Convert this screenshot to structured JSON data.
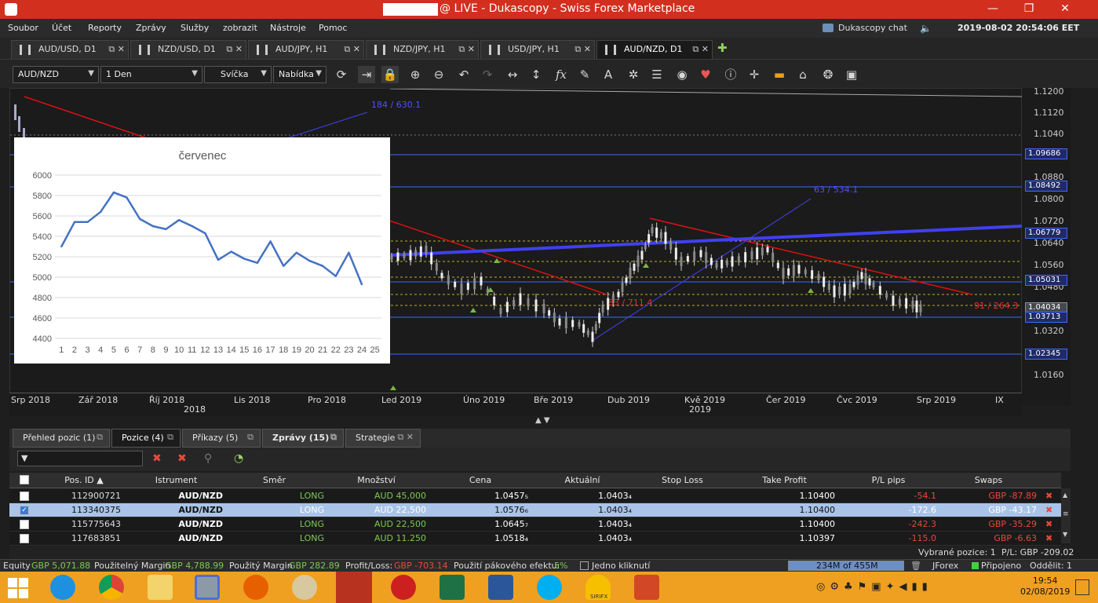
{
  "window": {
    "title": "@ LIVE - Dukascopy - Swiss Forex Marketplace",
    "minimize": "—",
    "maximize": "❐",
    "close": "✕"
  },
  "menu": [
    "Soubor",
    "Účet",
    "Reporty",
    "Zprávy",
    "Služby",
    "zobrazit",
    "Nástroje",
    "Pomoc"
  ],
  "header": {
    "chat_label": "Dukascopy chat",
    "datetime": "2019-08-02 20:54:06 EET"
  },
  "tabs": [
    "AUD/USD, D1",
    "NZD/USD, D1",
    "AUD/JPY, H1",
    "NZD/JPY, H1",
    "USD/JPY, H1",
    "AUD/NZD, D1"
  ],
  "tab_icons": "⧉ ✕",
  "toolbar": {
    "instrument": "AUD/NZD",
    "period": "1 Den",
    "chart_type": "Svíčka",
    "side": "Nabídka"
  },
  "price_axis": {
    "labels": [
      "1.1200",
      "1.1120",
      "1.1040",
      "1.0880",
      "1.0800",
      "1.0720",
      "1.0640",
      "1.0560",
      "1.0480",
      "1.0320",
      "1.0160"
    ],
    "boxes": [
      "1.09686",
      "1.08492",
      "1.06779",
      "1.05031",
      "1.04034",
      "1.03713",
      "1.02345"
    ]
  },
  "time_axis": {
    "months": [
      "Srp 2018",
      "Zář 2018",
      "Říj 2018",
      "Lis 2018",
      "Pro 2018",
      "Led 2019",
      "Úno 2019",
      "Bře 2019",
      "Dub 2019",
      "Kvě 2019",
      "Čer 2019",
      "Čvc 2019",
      "Srp 2019",
      "IX"
    ],
    "years": [
      "2018",
      "2019"
    ]
  },
  "chart_annotations": {
    "a1": "184 / 630.1",
    "a2": "63 / 534.1",
    "a3": "83 / 711.4",
    "a4": "91 / 264.3"
  },
  "chart_data": {
    "type": "line",
    "title": "červenec",
    "x": [
      1,
      2,
      3,
      4,
      5,
      6,
      7,
      8,
      9,
      10,
      11,
      12,
      13,
      14,
      15,
      16,
      17,
      18,
      19,
      20,
      21,
      22,
      23,
      24
    ],
    "x_ticks": [
      1,
      2,
      3,
      4,
      5,
      6,
      7,
      8,
      9,
      10,
      11,
      12,
      13,
      14,
      15,
      16,
      17,
      18,
      19,
      20,
      21,
      22,
      23,
      24,
      25
    ],
    "y_ticks": [
      4400,
      4600,
      4800,
      5000,
      5200,
      5400,
      5600,
      5800,
      6000
    ],
    "series": [
      {
        "values": [
          5300,
          5540,
          5540,
          5640,
          5830,
          5780,
          5570,
          5500,
          5470,
          5560,
          5500,
          5430,
          5170,
          5250,
          5180,
          5140,
          5350,
          5110,
          5240,
          5160,
          5110,
          5010,
          5240,
          4930
        ]
      }
    ],
    "ylim": [
      4400,
      6000
    ],
    "color": "#4472c4"
  },
  "positions": {
    "tabs": [
      {
        "label": "Přehled pozic (1)"
      },
      {
        "label": "Pozice (4)"
      },
      {
        "label": "Příkazy (5)"
      },
      {
        "label": "Zprávy (15)"
      },
      {
        "label": "Strategie"
      }
    ],
    "columns": [
      "Pos. ID",
      "Istrument",
      "Směr",
      "Množství",
      "Cena",
      "Aktuální",
      "Stop Loss",
      "Take Profit",
      "P/L pips",
      "Swaps"
    ],
    "rows": [
      {
        "id": "112900721",
        "instrument": "AUD/NZD",
        "dir": "LONG",
        "amount": "AUD 45,000",
        "price": "1.0457₅",
        "current": "1.0403₄",
        "sl": "",
        "tp": "1.10400",
        "pl": "-54.1",
        "swaps": "GBP -87.89",
        "checked": false
      },
      {
        "id": "113340375",
        "instrument": "AUD/NZD",
        "dir": "LONG",
        "amount": "AUD 22,500",
        "price": "1.0576₆",
        "current": "1.0403₄",
        "sl": "",
        "tp": "1.10400",
        "pl": "-172.6",
        "swaps": "GBP -43.17",
        "checked": true
      },
      {
        "id": "115775643",
        "instrument": "AUD/NZD",
        "dir": "LONG",
        "amount": "AUD 22,500",
        "price": "1.0645₇",
        "current": "1.0403₄",
        "sl": "",
        "tp": "1.10400",
        "pl": "-242.3",
        "swaps": "GBP -35.29",
        "checked": false
      },
      {
        "id": "117683851",
        "instrument": "AUD/NZD",
        "dir": "LONG",
        "amount": "AUD 11.250",
        "price": "1.0518₄",
        "current": "1.0403₄",
        "sl": "",
        "tp": "1.10397",
        "pl": "-115.0",
        "swaps": "GBP -6.63",
        "checked": false
      }
    ],
    "summary_selected": "Vybrané pozice:  1",
    "summary_pl": "P/L:  GBP -209.02"
  },
  "status": {
    "equity_label": "Equity",
    "equity": "GBP 5,071.88",
    "usable_margin_label": "Použitelný Margin",
    "usable_margin": "GBP 4,788.99",
    "used_margin_label": "Použitý Margin",
    "used_margin": "GBP 282.89",
    "pl_label": "Profit/Loss:",
    "pl": "GBP -703.14",
    "leverage_label": "Použití pákového efektu:",
    "leverage": "5%",
    "one_click": "Jedno kliknutí",
    "memory": "234M of 455M",
    "platform": "JForex",
    "connection": "Připojeno",
    "detach": "Oddělit: 1"
  },
  "taskbar": {
    "time": "19:54",
    "date": "02/08/2019",
    "app_label": "SIRIFX"
  }
}
